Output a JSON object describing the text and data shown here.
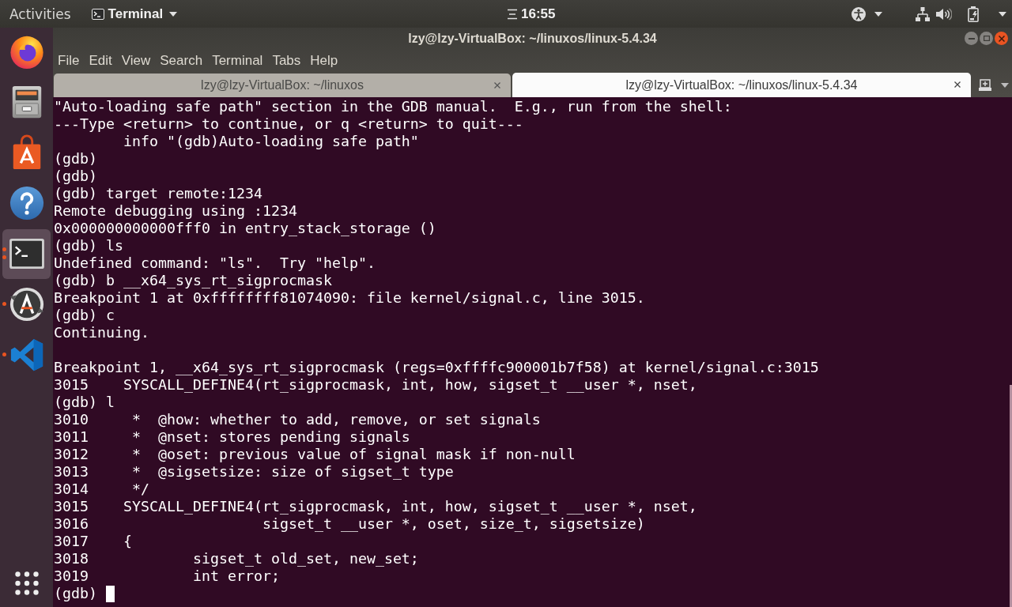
{
  "top_bar": {
    "activities": "Activities",
    "app_menu": "Terminal",
    "clock": "16:55"
  },
  "dock": {
    "items": [
      {
        "kind": "browser",
        "selected": false,
        "running": false,
        "multiple_windows": false
      },
      {
        "kind": "files",
        "selected": false,
        "running": false,
        "multiple_windows": false
      },
      {
        "kind": "store",
        "selected": false,
        "running": false,
        "multiple_windows": false
      },
      {
        "kind": "help",
        "selected": false,
        "running": false,
        "multiple_windows": false
      },
      {
        "kind": "terminal",
        "selected": true,
        "running": true,
        "multiple_windows": true
      },
      {
        "kind": "updater",
        "selected": false,
        "running": true,
        "multiple_windows": false
      },
      {
        "kind": "editor",
        "selected": false,
        "running": true,
        "multiple_windows": false
      }
    ]
  },
  "window": {
    "title": "lzy@lzy-VirtualBox: ~/linuxos/linux-5.4.34",
    "menu": [
      "File",
      "Edit",
      "View",
      "Search",
      "Terminal",
      "Tabs",
      "Help"
    ],
    "tabs": [
      {
        "label": "lzy@lzy-VirtualBox: ~/linuxos",
        "selected": false
      },
      {
        "label": "lzy@lzy-VirtualBox: ~/linuxos/linux-5.4.34",
        "selected": true
      }
    ],
    "terminal": {
      "cursor": true,
      "lines": [
        {
          "kind": "text",
          "text": "\"Auto-loading safe path\" section in the GDB manual.  E.g., run from the shell:"
        },
        {
          "kind": "text",
          "text": "---Type <return> to continue, or q <return> to quit---"
        },
        {
          "kind": "text",
          "text": "        info \"(gdb)Auto-loading safe path\""
        },
        {
          "kind": "text",
          "text": "(gdb)"
        },
        {
          "kind": "text",
          "text": "(gdb)"
        },
        {
          "kind": "text",
          "text": "(gdb) target remote:1234"
        },
        {
          "kind": "text",
          "text": "Remote debugging using :1234"
        },
        {
          "kind": "text",
          "text": "0x000000000000fff0 in entry_stack_storage ()"
        },
        {
          "kind": "text",
          "text": "(gdb) ls"
        },
        {
          "kind": "text",
          "text": "Undefined command: \"ls\".  Try \"help\"."
        },
        {
          "kind": "text",
          "text": "(gdb) b __x64_sys_rt_sigprocmask"
        },
        {
          "kind": "text",
          "text": "Breakpoint 1 at 0xffffffff81074090: file kernel/signal.c, line 3015."
        },
        {
          "kind": "text",
          "text": "(gdb) c"
        },
        {
          "kind": "text",
          "text": "Continuing."
        },
        {
          "kind": "blank"
        },
        {
          "kind": "text",
          "text": "Breakpoint 1, __x64_sys_rt_sigprocmask (regs=0xffffc900001b7f58) at kernel/signal.c:3015"
        },
        {
          "kind": "text",
          "text": "3015    SYSCALL_DEFINE4(rt_sigprocmask, int, how, sigset_t __user *, nset,"
        },
        {
          "kind": "text",
          "text": "(gdb) l"
        },
        {
          "kind": "text",
          "text": "3010     *  @how: whether to add, remove, or set signals"
        },
        {
          "kind": "text",
          "text": "3011     *  @nset: stores pending signals"
        },
        {
          "kind": "text",
          "text": "3012     *  @oset: previous value of signal mask if non-null"
        },
        {
          "kind": "text",
          "text": "3013     *  @sigsetsize: size of sigset_t type"
        },
        {
          "kind": "text",
          "text": "3014     */"
        },
        {
          "kind": "text",
          "text": "3015    SYSCALL_DEFINE4(rt_sigprocmask, int, how, sigset_t __user *, nset,"
        },
        {
          "kind": "text",
          "text": "3016                    sigset_t __user *, oset, size_t, sigsetsize)"
        },
        {
          "kind": "text",
          "text": "3017    {"
        },
        {
          "kind": "text",
          "text": "3018            sigset_t old_set, new_set;"
        },
        {
          "kind": "text",
          "text": "3019            int error;"
        },
        {
          "kind": "text",
          "text": "(gdb)"
        }
      ]
    }
  }
}
